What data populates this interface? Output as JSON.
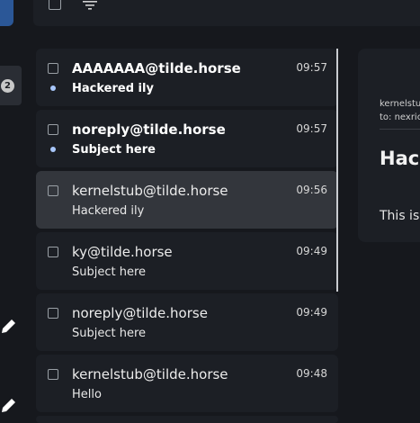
{
  "rail": {
    "badge_count": "2"
  },
  "toolbar": {
    "select_all_label": "",
    "filter_icon": "filter-icon"
  },
  "messages": [
    {
      "sender": "AAAAAAA@tilde.horse",
      "subject": "Hackered ily",
      "time": "09:57",
      "unread": true,
      "selected": false
    },
    {
      "sender": "noreply@tilde.horse",
      "subject": "Subject here",
      "time": "09:57",
      "unread": true,
      "selected": false
    },
    {
      "sender": "kernelstub@tilde.horse",
      "subject": "Hackered ily",
      "time": "09:56",
      "unread": false,
      "selected": true
    },
    {
      "sender": "ky@tilde.horse",
      "subject": "Subject here",
      "time": "09:49",
      "unread": false,
      "selected": false
    },
    {
      "sender": "noreply@tilde.horse",
      "subject": "Subject here",
      "time": "09:49",
      "unread": false,
      "selected": false
    },
    {
      "sender": "kernelstub@tilde.horse",
      "subject": "Hello",
      "time": "09:48",
      "unread": false,
      "selected": false
    }
  ],
  "reading_pane": {
    "from": "kernelstu",
    "to": "to: nexric",
    "title": "Hack",
    "body": "This is"
  },
  "colors": {
    "background": "#16181d",
    "panel": "#1c1f25",
    "selected": "#33363c",
    "unread_dot": "#a8c7fa",
    "brand_tile": "#2b5797"
  }
}
